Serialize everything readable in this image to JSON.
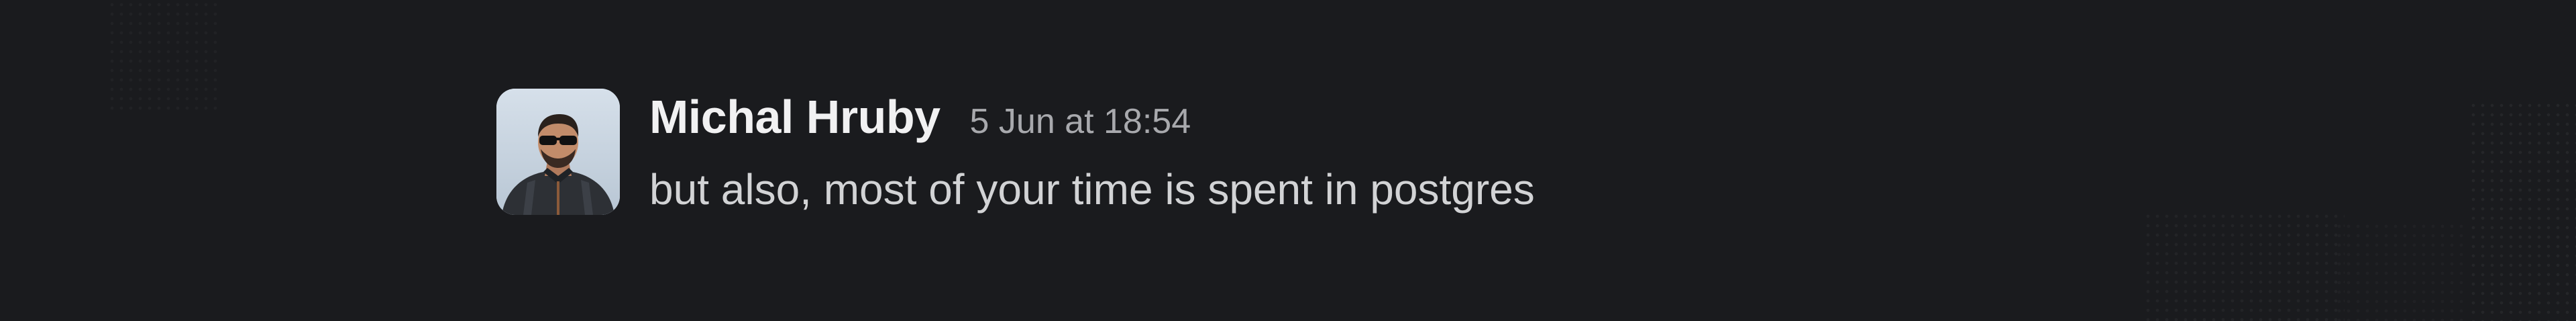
{
  "message": {
    "author": "Michal Hruby",
    "timestamp": "5 Jun at 18:54",
    "text": "but also, most of your time is spent in postgres"
  },
  "colors": {
    "background": "#1a1b1e",
    "author": "#f1f1f2",
    "timestamp": "#a8a9ad",
    "text": "#d2d3d5"
  },
  "icons": {
    "avatar": "user-photo"
  }
}
